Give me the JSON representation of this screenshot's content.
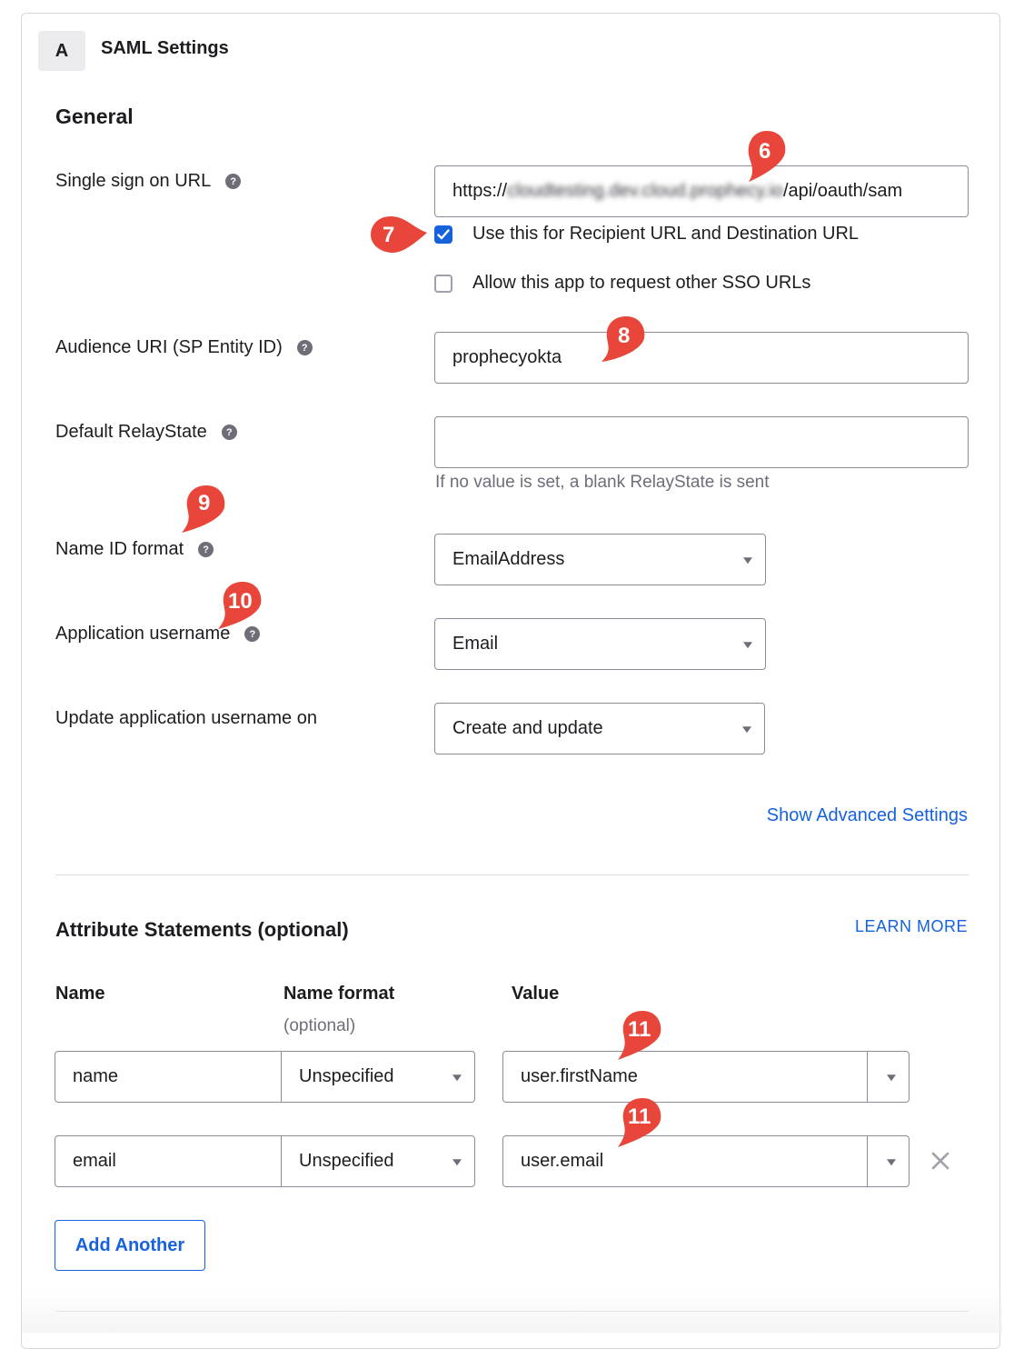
{
  "header": {
    "badge": "A",
    "title": "SAML Settings"
  },
  "general": {
    "heading": "General",
    "sso_url": {
      "label": "Single sign on URL",
      "value_prefix": "https://",
      "value_blurred": "cloudtesting.dev.cloud.prophecy.io",
      "value_suffix": "/api/oauth/sam"
    },
    "recipient_checkbox": {
      "label": "Use this for Recipient URL and Destination URL",
      "checked": true
    },
    "other_sso_checkbox": {
      "label": "Allow this app to request other SSO URLs",
      "checked": false
    },
    "audience_uri": {
      "label": "Audience URI (SP Entity ID)",
      "value": "prophecyokta"
    },
    "relay_state": {
      "label": "Default RelayState",
      "value": "",
      "hint": "If no value is set, a blank RelayState is sent"
    },
    "name_id_format": {
      "label": "Name ID format",
      "selected": "EmailAddress"
    },
    "app_username": {
      "label": "Application username",
      "selected": "Email"
    },
    "update_username": {
      "label": "Update application username on",
      "selected": "Create and update"
    },
    "advanced_link": "Show Advanced Settings"
  },
  "attributes": {
    "heading": "Attribute Statements (optional)",
    "learn_more": "LEARN MORE",
    "columns": {
      "name": "Name",
      "name_format": "Name format",
      "name_format_sub": "(optional)",
      "value": "Value"
    },
    "rows": [
      {
        "name": "name",
        "format": "Unspecified",
        "value": "user.firstName"
      },
      {
        "name": "email",
        "format": "Unspecified",
        "value": "user.email"
      }
    ],
    "add_button": "Add Another"
  },
  "annotations": [
    "6",
    "7",
    "8",
    "9",
    "10",
    "11",
    "11"
  ],
  "colors": {
    "accent": "#1662dd",
    "marker": "#e8463a"
  }
}
